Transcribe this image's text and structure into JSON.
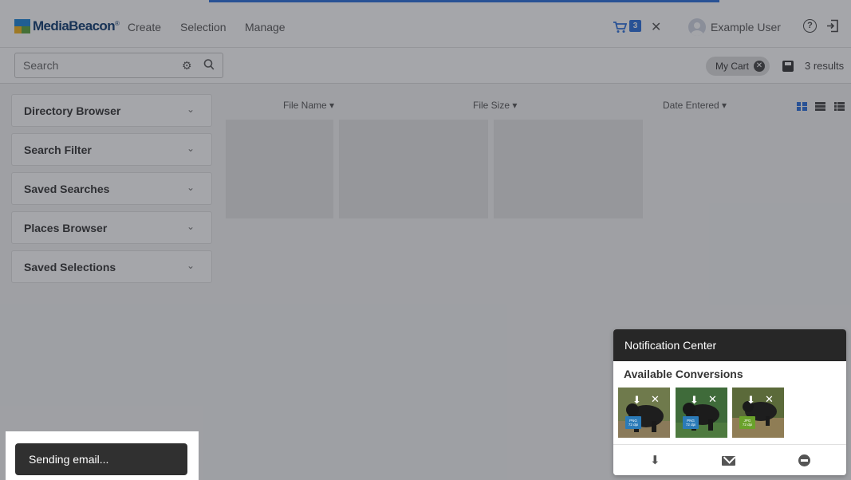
{
  "header": {
    "logo_text": "MediaBeacon",
    "logo_mark": "®",
    "nav": [
      "Create",
      "Selection",
      "Manage"
    ],
    "cart_icon": "cart-icon",
    "cart_count": "3",
    "close_glyph": "✕",
    "user_name": "Example User",
    "help_glyph": "?"
  },
  "search": {
    "placeholder": "Search",
    "filter_glyph": "⚙",
    "cart_chip": "My Cart",
    "cart_chip_close": "✕",
    "results": "3 results"
  },
  "sidebar": {
    "panels": [
      "Directory Browser",
      "Search Filter",
      "Saved Searches",
      "Places Browser",
      "Saved Selections"
    ],
    "chevron": "⌄"
  },
  "columns": {
    "file_name": "File Name ▾",
    "file_size": "File Size ▾",
    "date_entered": "Date Entered ▾"
  },
  "toast": {
    "message": "Sending email..."
  },
  "notification_center": {
    "title": "Notification Center",
    "subtitle": "Available Conversions",
    "conversions": [
      {
        "format": "PNG",
        "dpi": "72 dpi",
        "download": "⬇",
        "close": "✕",
        "badge_color": "#2b7bb8"
      },
      {
        "format": "PNG",
        "dpi": "72 dpi",
        "download": "⬇",
        "close": "✕",
        "badge_color": "#2b7bb8"
      },
      {
        "format": "JPG",
        "dpi": "72 dpi",
        "download": "⬇",
        "close": "✕",
        "badge_color": "#6aa12b"
      }
    ],
    "footer_download": "⬇"
  },
  "colors": {
    "accent": "#2a6fdb",
    "overlay": "rgba(40,44,52,0.42)",
    "notif_header": "#272727",
    "toast": "#303030"
  }
}
